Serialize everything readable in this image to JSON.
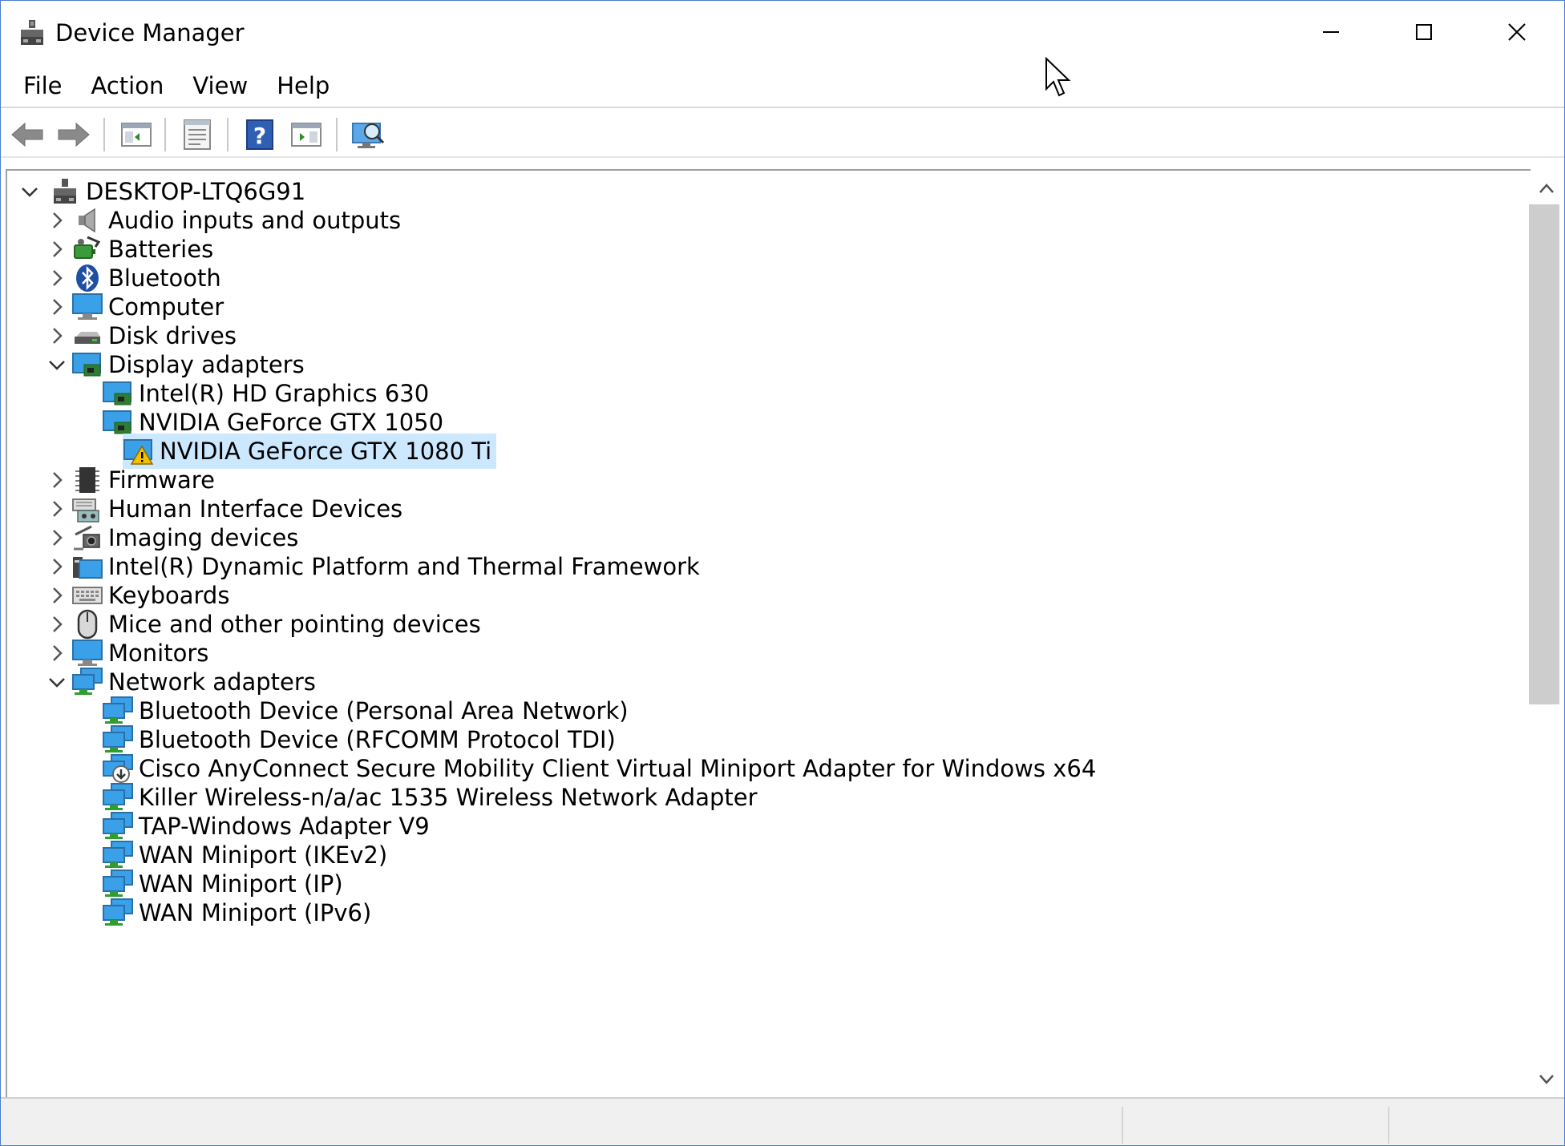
{
  "window": {
    "title": "Device Manager"
  },
  "menu": [
    "File",
    "Action",
    "View",
    "Help"
  ],
  "toolbar": {
    "buttons": [
      "back-icon",
      "forward-icon",
      "show-hide-console-tree-icon",
      "properties-icon",
      "help-icon",
      "show-action-pane-icon",
      "scan-hardware-icon"
    ]
  },
  "tree": {
    "root": "DESKTOP-LTQ6G91",
    "audio": "Audio inputs and outputs",
    "batteries": "Batteries",
    "bluetooth": "Bluetooth",
    "computer": "Computer",
    "disk": "Disk drives",
    "display": "Display adapters",
    "display_children": [
      "Intel(R) HD Graphics 630",
      "NVIDIA GeForce GTX 1050",
      "NVIDIA GeForce GTX 1080 Ti"
    ],
    "firmware": "Firmware",
    "hid": "Human Interface Devices",
    "imaging": "Imaging devices",
    "intel_dptf": "Intel(R) Dynamic Platform and Thermal Framework",
    "keyboards": "Keyboards",
    "mice": "Mice and other pointing devices",
    "monitors": "Monitors",
    "network": "Network adapters",
    "network_children": [
      "Bluetooth Device (Personal Area Network)",
      "Bluetooth Device (RFCOMM Protocol TDI)",
      "Cisco AnyConnect Secure Mobility Client Virtual Miniport Adapter for Windows x64",
      "Killer Wireless-n/a/ac 1535 Wireless Network Adapter",
      "TAP-Windows Adapter V9",
      "WAN Miniport (IKEv2)",
      "WAN Miniport (IP)",
      "WAN Miniport (IPv6)"
    ],
    "selected": "NVIDIA GeForce GTX 1080 Ti",
    "warning_device": "NVIDIA GeForce GTX 1080 Ti"
  },
  "colors": {
    "selection": "#cce8ff",
    "window_border": "#4a7fd0",
    "warning": "#f5c000"
  }
}
